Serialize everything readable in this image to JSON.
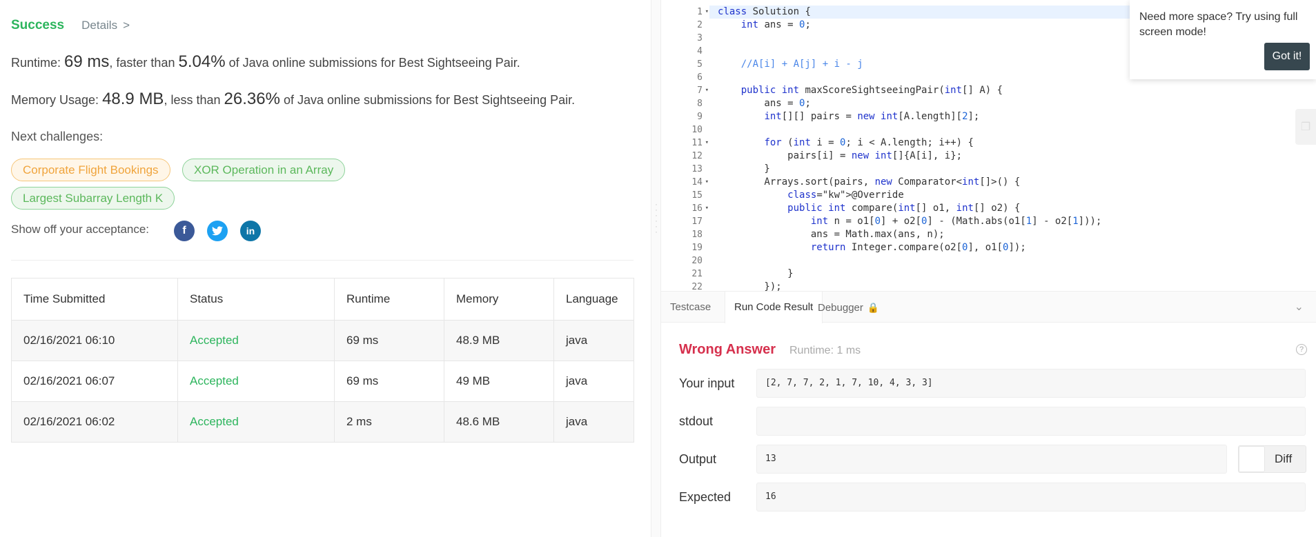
{
  "header": {
    "status": "Success",
    "details_label": "Details",
    "details_chevron": ">"
  },
  "runtime": {
    "label": "Runtime:",
    "value": "69 ms",
    "mid": ", faster than",
    "percent": "5.04%",
    "tail": "of Java online submissions for Best Sightseeing Pair."
  },
  "memory": {
    "label": "Memory Usage:",
    "value": "48.9 MB",
    "mid": ", less than",
    "percent": "26.36%",
    "tail": "of Java online submissions for Best Sightseeing Pair."
  },
  "next_challenges": {
    "label": "Next challenges:",
    "items": [
      {
        "label": "Corporate Flight Bookings",
        "color": "#f0a43c"
      },
      {
        "label": "XOR Operation in an Array",
        "color": "#5cb85c"
      },
      {
        "label": "Largest Subarray Length K",
        "color": "#5cb85c"
      }
    ]
  },
  "share": {
    "label": "Show off your acceptance:",
    "icons": [
      {
        "name": "facebook-icon",
        "glyph": "f"
      },
      {
        "name": "twitter-icon",
        "glyph": "t"
      },
      {
        "name": "linkedin-icon",
        "glyph": "in"
      }
    ]
  },
  "submissions": {
    "columns": [
      "Time Submitted",
      "Status",
      "Runtime",
      "Memory",
      "Language"
    ],
    "rows": [
      [
        "02/16/2021 06:10",
        "Accepted",
        "69 ms",
        "48.9 MB",
        "java"
      ],
      [
        "02/16/2021 06:07",
        "Accepted",
        "69 ms",
        "49 MB",
        "java"
      ],
      [
        "02/16/2021 06:02",
        "Accepted",
        "2 ms",
        "48.6 MB",
        "java"
      ]
    ]
  },
  "editor": {
    "line_numbers": [
      "1",
      "2",
      "3",
      "4",
      "5",
      "6",
      "7",
      "8",
      "9",
      "10",
      "11",
      "12",
      "13",
      "14",
      "15",
      "16",
      "17",
      "18",
      "19",
      "20",
      "21",
      "22"
    ],
    "fold_lines": [
      1,
      7,
      11,
      14,
      16
    ],
    "lines": [
      "class Solution {",
      "    int ans = 0;",
      "",
      "",
      "    //A[i] + A[j] + i - j",
      "",
      "    public int maxScoreSightseeingPair(int[] A) {",
      "        ans = 0;",
      "        int[][] pairs = new int[A.length][2];",
      "",
      "        for (int i = 0; i < A.length; i++) {",
      "            pairs[i] = new int[]{A[i], i};",
      "        }",
      "        Arrays.sort(pairs, new Comparator<int[]>() {",
      "            @Override",
      "            public int compare(int[] o1, int[] o2) {",
      "                int n = o1[0] + o2[0] - (Math.abs(o1[1] - o2[1]));",
      "                ans = Math.max(ans, n);",
      "                return Integer.compare(o2[0], o1[0]);",
      "",
      "            }",
      "        });"
    ]
  },
  "tooltip": {
    "text": "Need more space? Try using full screen mode!",
    "button": "Got it!"
  },
  "console": {
    "tabs": [
      "Testcase",
      "Run Code Result",
      "Debugger"
    ],
    "active_tab": 1,
    "result_title": "Wrong Answer",
    "result_runtime": "Runtime: 1 ms",
    "help_glyph": "?",
    "input_label": "Your input",
    "input_value": "[2, 7, 7, 2, 1, 7, 10, 4, 3, 3]",
    "stdout_label": "stdout",
    "stdout_value": "",
    "output_label": "Output",
    "output_value": "13",
    "diff_label": "Diff",
    "expected_label": "Expected",
    "expected_value": "16"
  },
  "colors": {
    "accent_green": "#2db55d",
    "wrong_red": "#d6304d",
    "editor_active_line": "#e8f2ff"
  }
}
